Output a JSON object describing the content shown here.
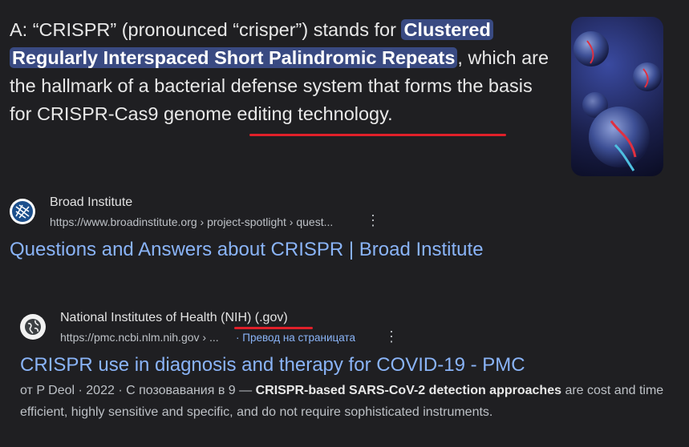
{
  "answer": {
    "prefix": "A: “CRISPR” (pronounced “crisper”) stands for ",
    "highlight1": "Clustered",
    "highlight2": "Regularly Interspaced Short Palindromic Repeats",
    "middle": ", which are the hallmark of a bacterial defense system that forms the basis for CRISPR-Cas9 ",
    "underlined": "genome editing technology",
    "suffix": "."
  },
  "result1": {
    "site_name": "Broad Institute",
    "url": "https://www.broadinstitute.org › project-spotlight › quest...",
    "title": "Questions and Answers about CRISPR | Broad Institute",
    "favicon_icon": "broad-institute-logo-icon"
  },
  "result2": {
    "site_name": "National Institutes of Health (NIH) (.gov)",
    "url": "https://pmc.ncbi.nlm.nih.gov › ...",
    "translate": "· Превод на страницата",
    "title": "CRISPR use in diagnosis and therapy for COVID-19 - PMC",
    "snippet_meta": "от P Deol · 2022 · С позовавания в 9 — ",
    "snippet_bold": "CRISPR-based SARS-CoV-2 detection approaches",
    "snippet_rest": " are cost and time efficient, highly sensitive and specific, and do not require sophisticated instruments.",
    "favicon_icon": "globe-icon"
  },
  "colors": {
    "background": "#1f1f22",
    "link": "#8ab4f8",
    "highlight": "#394a82",
    "annotation_red": "#e0202a"
  }
}
